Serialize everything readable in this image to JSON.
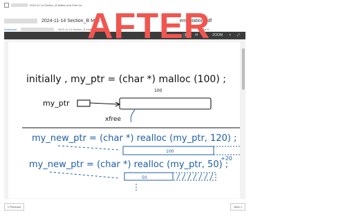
{
  "breadcrumb": {
    "text": "2024-11-14 Section_B Malloc and Free Im..."
  },
  "file": {
    "title": "2024-11-14 Section_B Mall",
    "title_end": "ementation.pdf"
  },
  "subbar": {
    "download": "Download",
    "text": "2024-11-14 Section_B Malloc and",
    "tail": "ative fo"
  },
  "toolbar": {
    "zoom": "ZOOM",
    "zoom_out": "−",
    "zoom_in": "+",
    "page_current": "1",
    "page_total": "/4"
  },
  "overlay": {
    "text": "AFTER"
  },
  "note": {
    "line1": "initially ,  my_ptr = (char *) malloc (100) ;",
    "label_100_top": "100",
    "my_ptr_label": "my_ptr",
    "free_label": "xfree",
    "line2": "my_new_ptr = (char *)  realloc (my_ptr, 120) ;",
    "label_100_mid": "100",
    "label_plus20": "+20",
    "line3": "my_new_ptr = (char *)  realloc (my_ptr, 50) ;",
    "label_50": "50"
  },
  "pager": {
    "previous": "« Previous",
    "next": "Next »"
  },
  "colors": {
    "overlay": "#f0564f",
    "ink_black": "#111111",
    "ink_blue": "#1f5fa6",
    "link": "#1a5fb4"
  }
}
